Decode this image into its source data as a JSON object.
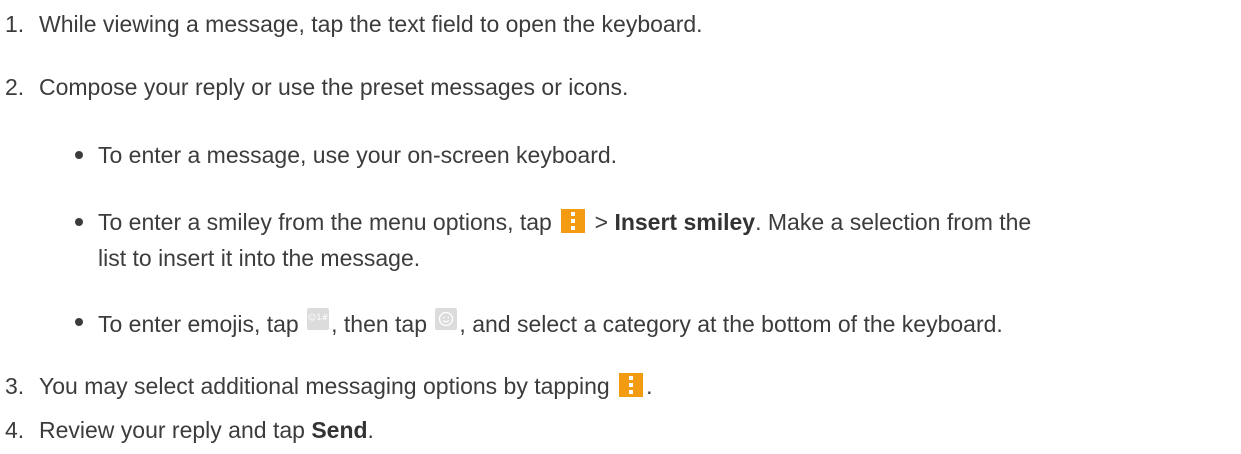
{
  "steps": [
    {
      "num": "1.",
      "text": "While viewing a message, tap the text field to open the keyboard."
    },
    {
      "num": "2.",
      "text": "Compose your reply or use the preset messages or icons."
    },
    {
      "num": "3.",
      "text_before": "You may select additional messaging options by tapping",
      "text_after": "."
    },
    {
      "num": "4.",
      "text_before": "Review your reply and tap ",
      "bold": "Send",
      "text_after": "."
    }
  ],
  "bullets": {
    "b1": "To enter a message, use your on-screen keyboard.",
    "b2": {
      "before": "To enter a smiley from the menu options, tap",
      "sep": " > ",
      "bold": "Insert smiley",
      "after": ". Make a selection from the",
      "line2": "list to insert it into the message."
    },
    "b3": {
      "before": "To enter emojis, tap",
      "mid": ", then tap",
      "after": ", and select a category at the bottom of the keyboard."
    }
  },
  "icons": {
    "menu": "menu-icon",
    "symbols": "symbols-key-icon",
    "symbols_label": "☺1#",
    "emoji": "emoji-key-icon",
    "menu_color": "#f39c12"
  }
}
